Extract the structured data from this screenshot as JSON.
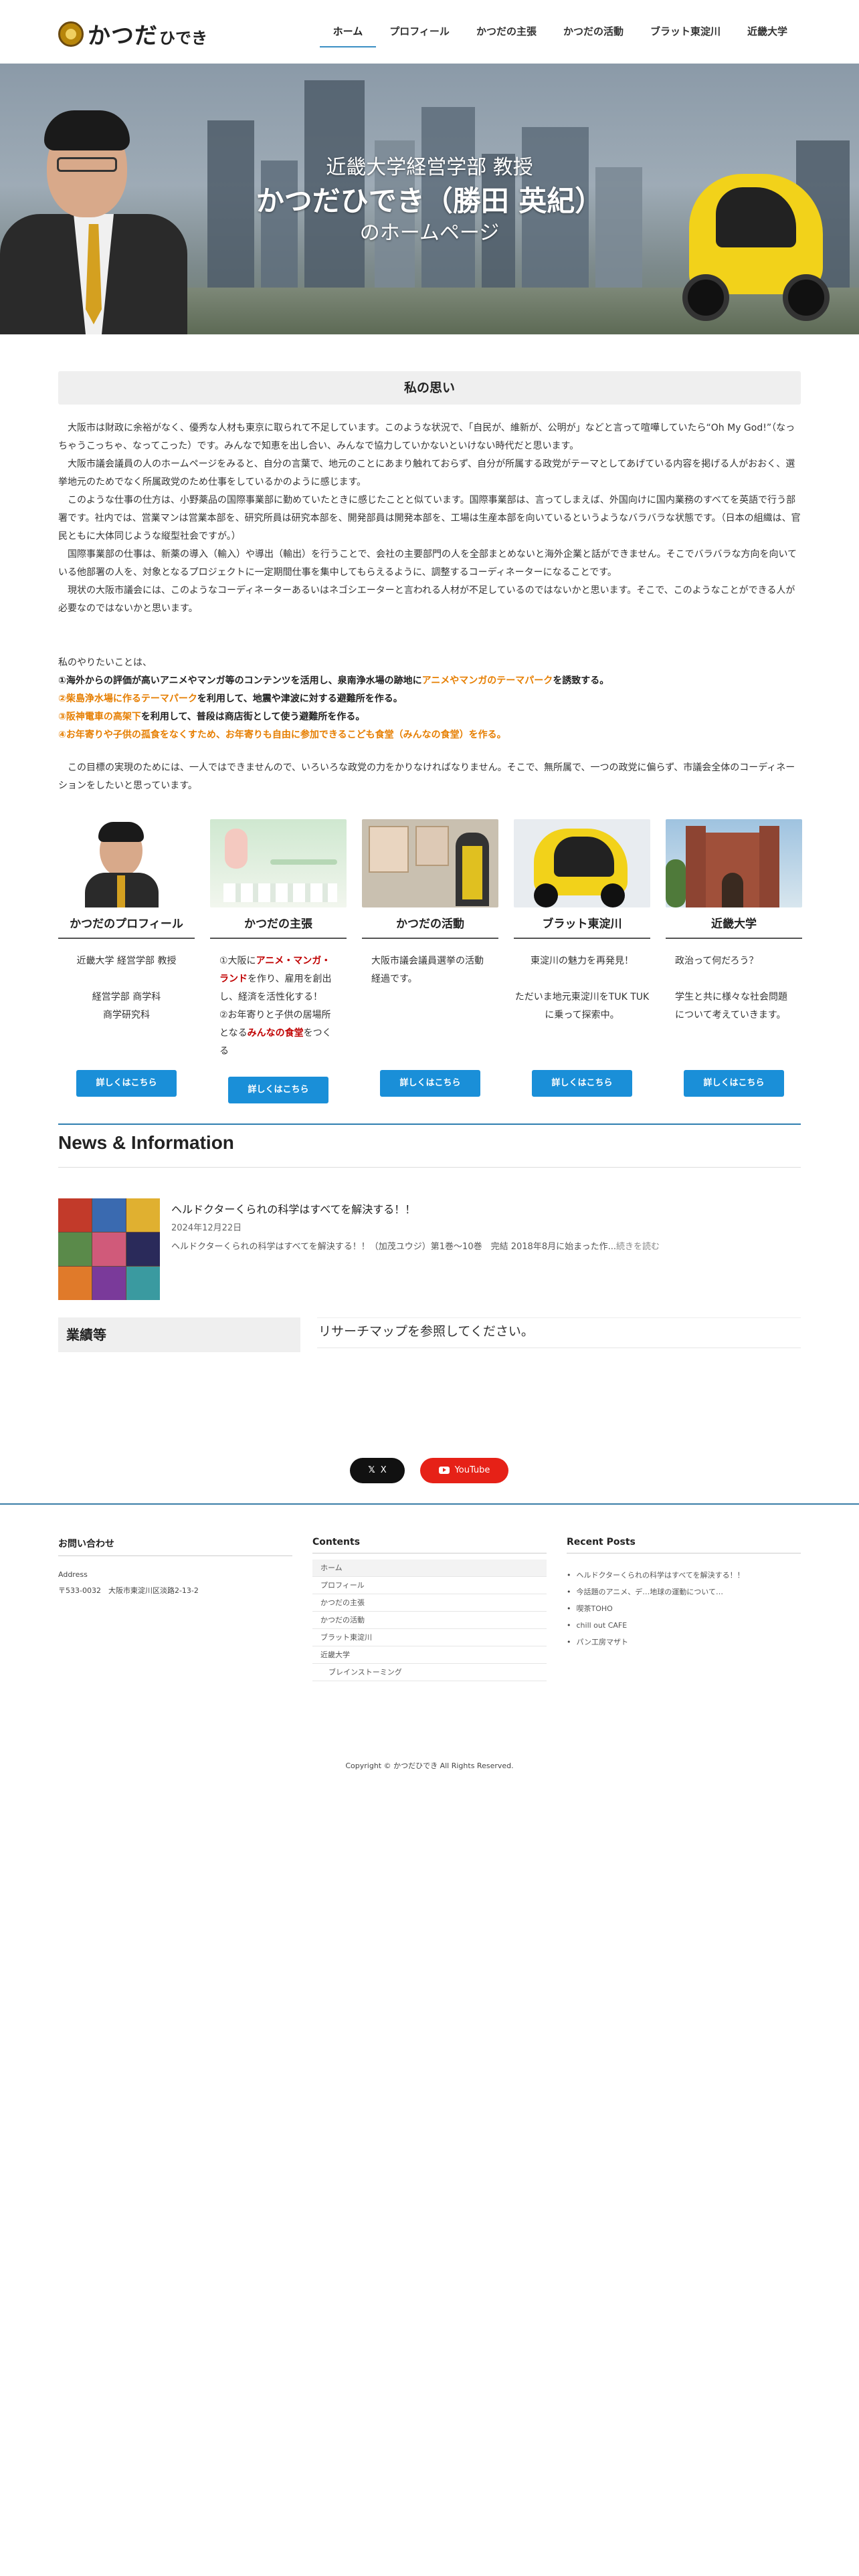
{
  "header": {
    "logo_text": "かつだ",
    "logo_sub": "ひでき",
    "nav": [
      "ホーム",
      "プロフィール",
      "かつだの主張",
      "かつだの活動",
      "ブラット東淀川",
      "近畿大学"
    ]
  },
  "hero": {
    "line1": "近畿大学経営学部 教授",
    "line2": "かつだひでき（勝田 英紀）",
    "line3": "のホームページ"
  },
  "thoughts": {
    "title": "私の思い",
    "paragraphs": [
      "大阪市は財政に余裕がなく、優秀な人材も東京に取られて不足しています。このような状況で、「自民が、維新が、公明が」などと言って喧嘩していたら“Oh My God!”（なっちゃうこっちゃ、なってこった）です。みんなで知恵を出し合い、みんなで協力していかないといけない時代だと思います。",
      "大阪市議会議員の人のホームページをみると、自分の言葉で、地元のことにあまり触れておらず、自分が所属する政党がテーマとしてあげている内容を掲げる人がおおく、選挙地元のためでなく所属政党のため仕事をしているかのように感じます。",
      "このような仕事の仕方は、小野薬品の国際事業部に勤めていたときに感じたことと似ています。国際事業部は、言ってしまえば、外国向けに国内業務のすべてを英語で行う部署です。社内では、営業マンは営業本部を、研究所員は研究本部を、開発部員は開発本部を、工場は生産本部を向いているというようなバラバラな状態です。（日本の組織は、官民ともに大体同じような縦型社会ですが。）",
      "国際事業部の仕事は、新薬の導入（輸入）や導出（輸出）を行うことで、会社の主要部門の人を全部まとめないと海外企業と話ができません。そこでバラバラな方向を向いている他部署の人を、対象となるプロジェクトに一定期間仕事を集中してもらえるように、調整するコーディネーターになることです。",
      "現状の大阪市議会には、このようなコーディネーターあるいはネゴシエーターと言われる人材が不足しているのではないかと思います。そこで、このようなことができる人が必要なのではないかと思います。"
    ],
    "plans_intro": "私のやりたいことは、",
    "plan1": {
      "pre": "①海外からの評価が高いアニメやマンガ等のコンテンツを活用し、泉南浄水場の跡地に",
      "hl": "アニメやマンガのテーマパーク",
      "post": "を誘致する。"
    },
    "plan2": {
      "hl": "②柴島浄水場に作るテーマパーク",
      "post": "を利用して、地震や津波に対する避難所を作る。"
    },
    "plan3": {
      "hl": "③阪神電車の高架下",
      "post": "を利用して、普段は商店街として使う避難所を作る。"
    },
    "plan4": "④お年寄りや子供の孤食をなくすため、お年寄りも自由に参加できるこども食堂（みんなの食堂）を作る。",
    "closing": "この目標の実現のためには、一人ではできませんので、いろいろな政党の力をかりなければなりません。そこで、無所属で、一つの政党に偏らず、市議会全体のコーディネーションをしたいと思っています。"
  },
  "cards": [
    {
      "title": "かつだのプロフィール",
      "desc": "近畿大学 経営学部 教授\n\n経営学部 商学科\n商学研究科",
      "button": "詳しくはこちら"
    },
    {
      "title": "かつだの主張",
      "desc_a": "①大阪に",
      "desc_hl1": "アニメ・マンガ・ランド",
      "desc_b": "を作り、雇用を創出し、経済を活性化する！\n②お年寄りと子供の居場所となる",
      "desc_hl2": "みんなの食堂",
      "desc_c": "をつくる",
      "button": "詳しくはこちら"
    },
    {
      "title": "かつだの活動",
      "desc": "大阪市議会議員選挙の活動経過です。",
      "button": "詳しくはこちら"
    },
    {
      "title": "ブラット東淀川",
      "desc": "東淀川の魅力を再発見！\n\nただいま地元東淀川をTUK TUKに乗って探索中。",
      "button": "詳しくはこちら"
    },
    {
      "title": "近畿大学",
      "desc": "政治って何だろう？\n\n学生と共に様々な社会問題について考えていきます。",
      "button": "詳しくはこちら"
    }
  ],
  "news": {
    "heading": "News & Information",
    "post_title": "ヘルドクターくられの科学はすべてを解決する！！",
    "date": "2024年12月22日",
    "excerpt": "ヘルドクターくられの科学はすべてを解決する！！（加茂ユウジ）第1巻～10巻　完結 2018年8月に始まった作...",
    "read_more": "続きを読む"
  },
  "achievements": {
    "heading": "業績等",
    "text": "リサーチマップを参照してください。"
  },
  "social": {
    "x_label": "X",
    "youtube_label": "YouTube"
  },
  "footer": {
    "contact_heading": "お問い合わせ",
    "address_label": "Address",
    "address": "〒533-0032　大阪市東淀川区淡路2-13-2",
    "contents_heading": "Contents",
    "menu": [
      "ホーム",
      "プロフィール",
      "かつだの主張",
      "かつだの活動",
      "ブラット東淀川",
      "近畿大学",
      "ブレインストーミング"
    ],
    "recent_heading": "Recent Posts",
    "recent": [
      "ヘルドクターくられの科学はすべてを解決する！！",
      "今話題のアニメ、デ…地球の運動について…",
      "喫茶TOHO",
      "chill out CAFE",
      "パン工房マザト"
    ],
    "copyright": "Copyright © かつだひでき All Rights Reserved."
  },
  "colors": {
    "accent": "#1a8fd8",
    "nav_underline": "#3b8fc4",
    "highlight_orange": "#e67e00",
    "highlight_red": "#c00000",
    "youtube": "#e62117"
  }
}
